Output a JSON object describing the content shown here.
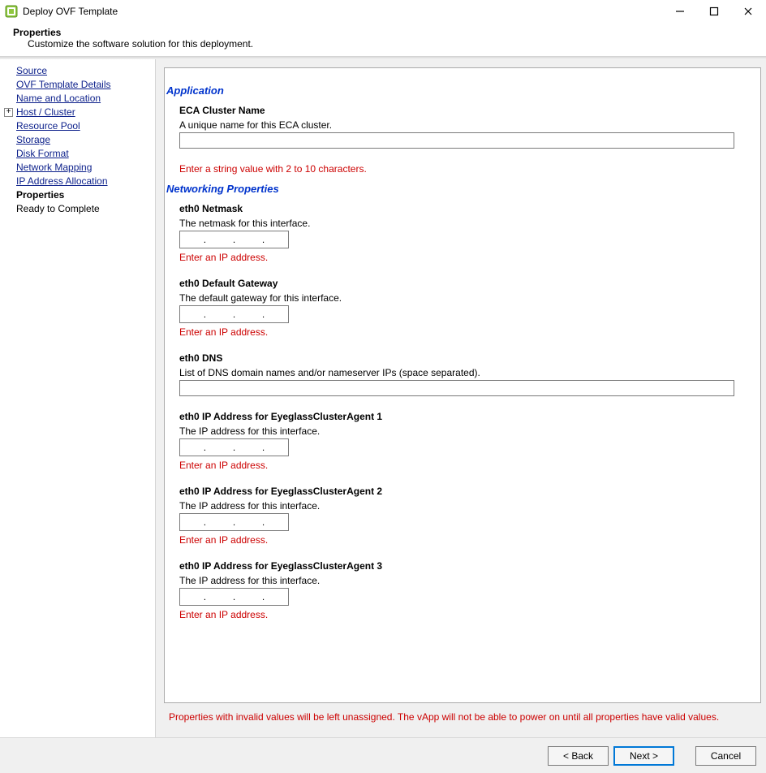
{
  "window": {
    "title": "Deploy OVF Template",
    "controls": {
      "minimize": "—",
      "maximize": "▢",
      "close": "✕"
    }
  },
  "header": {
    "title": "Properties",
    "subtitle": "Customize the software solution for this deployment."
  },
  "sidebar": {
    "items": [
      {
        "label": "Source",
        "state": "link",
        "key": "source"
      },
      {
        "label": "OVF Template Details",
        "state": "link",
        "key": "ovf-template-details"
      },
      {
        "label": "Name and Location",
        "state": "link",
        "key": "name-and-location"
      },
      {
        "label": "Host / Cluster",
        "state": "link",
        "key": "host-cluster",
        "expandable": true
      },
      {
        "label": "Resource Pool",
        "state": "link",
        "key": "resource-pool"
      },
      {
        "label": "Storage",
        "state": "link",
        "key": "storage"
      },
      {
        "label": "Disk Format",
        "state": "link",
        "key": "disk-format"
      },
      {
        "label": "Network Mapping",
        "state": "link",
        "key": "network-mapping"
      },
      {
        "label": "IP Address Allocation",
        "state": "link",
        "key": "ip-address-allocation"
      },
      {
        "label": "Properties",
        "state": "current",
        "key": "properties"
      },
      {
        "label": "Ready to Complete",
        "state": "plain",
        "key": "ready-to-complete"
      }
    ]
  },
  "sections": {
    "application": {
      "title": "Application",
      "eca": {
        "label": "ECA Cluster Name",
        "desc": "A unique name for this ECA cluster.",
        "value": "",
        "error": "Enter a string value with 2 to 10 characters."
      }
    },
    "networking": {
      "title": "Networking Properties",
      "fields": [
        {
          "key": "netmask",
          "label": "eth0 Netmask",
          "desc": "The netmask for this interface.",
          "type": "ip",
          "value": "",
          "error": "Enter an IP address."
        },
        {
          "key": "gateway",
          "label": "eth0 Default Gateway",
          "desc": "The default gateway for this interface.",
          "type": "ip",
          "value": "",
          "error": "Enter an IP address."
        },
        {
          "key": "dns",
          "label": "eth0 DNS",
          "desc": "List of DNS domain names and/or nameserver IPs (space separated).",
          "type": "text",
          "value": "",
          "error": ""
        },
        {
          "key": "eth0-ip-1",
          "label": "eth0 IP Address for EyeglassClusterAgent 1",
          "desc": "The IP address for this interface.",
          "type": "ip",
          "value": "",
          "error": "Enter an IP address."
        },
        {
          "key": "eth0-ip-2",
          "label": "eth0 IP Address for EyeglassClusterAgent 2",
          "desc": "The IP address for this interface.",
          "type": "ip",
          "value": "",
          "error": "Enter an IP address."
        },
        {
          "key": "eth0-ip-3",
          "label": "eth0 IP Address for EyeglassClusterAgent 3",
          "desc": "The IP address for this interface.",
          "type": "ip",
          "value": "",
          "error": "Enter an IP address."
        }
      ]
    }
  },
  "warning": "Properties with invalid values will be left unassigned. The vApp will not be able to power on until all properties have valid values.",
  "footer": {
    "back": "< Back",
    "next": "Next >",
    "cancel": "Cancel"
  }
}
